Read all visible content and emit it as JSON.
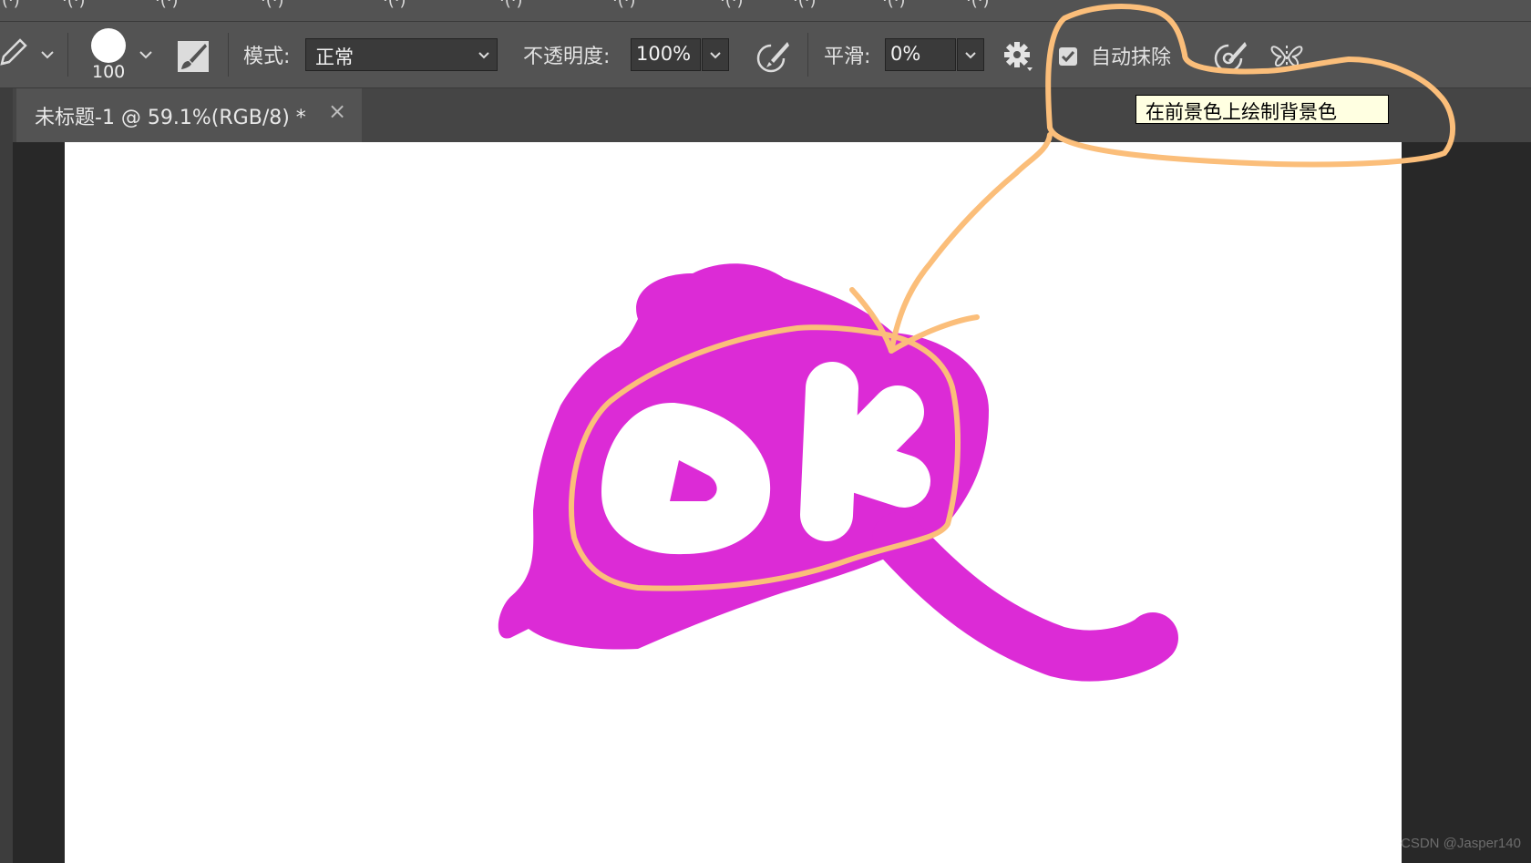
{
  "menubar": {
    "fragments": [
      "(·)",
      "·(·)",
      "·(·)",
      "·(·)",
      "·(·)",
      "·(·)",
      "·(·)",
      "·(·)",
      "·(·)",
      "·(·)",
      "·(·)"
    ]
  },
  "options": {
    "brush_size": "100",
    "mode_label": "模式:",
    "mode_value": "正常",
    "opacity_label": "不透明度:",
    "opacity_value": "100%",
    "smoothing_label": "平滑:",
    "smoothing_value": "0%",
    "auto_erase_label": "自动抹除",
    "auto_erase_checked": true
  },
  "tooltip": {
    "text": "在前景色上绘制背景色"
  },
  "document": {
    "tab_title": "未标题-1 @ 59.1%(RGB/8) *",
    "close_glyph": "×"
  },
  "watermark": "CSDN @Jasper140",
  "icons": [
    "pencil-icon",
    "chevron-down-icon",
    "brush-tip-icon",
    "brush-settings-icon",
    "airbrush-pressure-icon",
    "gear-icon",
    "checkbox-checked-icon",
    "pressure-size-icon",
    "symmetry-butterfly-icon",
    "close-icon"
  ],
  "colors": {
    "ui_bg": "#535353",
    "canvas_bg": "#282828",
    "paint_magenta": "#dc2bd6",
    "annotation_orange": "#fbbe7a",
    "tooltip_bg": "#ffffe1"
  }
}
